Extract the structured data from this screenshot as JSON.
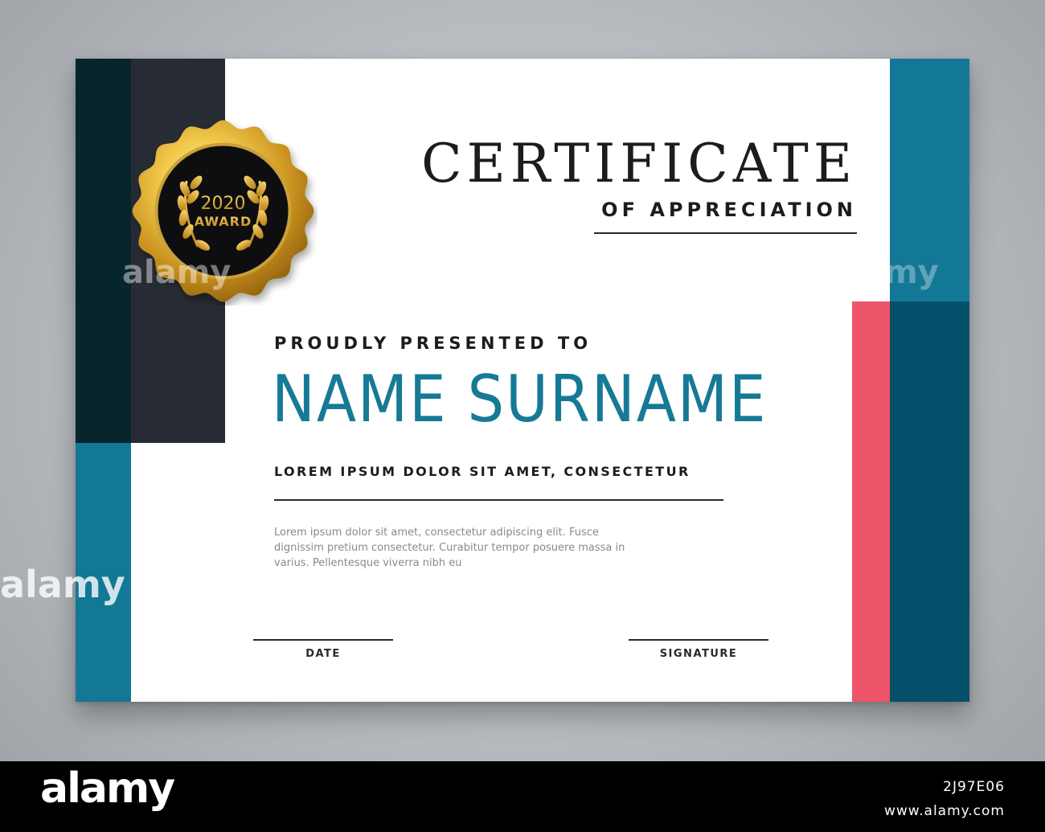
{
  "certificate": {
    "title": "CERTIFICATE",
    "subtitle": "OF APPRECIATION",
    "presented_to": "PROUDLY PRESENTED TO",
    "name": "NAME SURNAME",
    "tagline": "LOREM IPSUM DOLOR SIT AMET, CONSECTETUR",
    "body": "Lorem ipsum dolor sit amet, consectetur adipiscing elit. Fusce dignissim pretium consectetur. Curabitur tempor posuere massa in varius. Pellentesque viverra nibh eu",
    "date_label": "DATE",
    "signature_label": "SIGNATURE"
  },
  "badge": {
    "year": "2020",
    "label": "AWARD"
  },
  "colors": {
    "teal": "#137896",
    "dark_teal": "#05506a",
    "charcoal": "#272b33",
    "near_black": "#07252d",
    "coral": "#ef5568",
    "gold": "#d9a92c",
    "name_blue": "#167a96"
  },
  "watermark": {
    "brand": "alamy",
    "image_id": "2J97E06",
    "site": "www.alamy.com"
  }
}
